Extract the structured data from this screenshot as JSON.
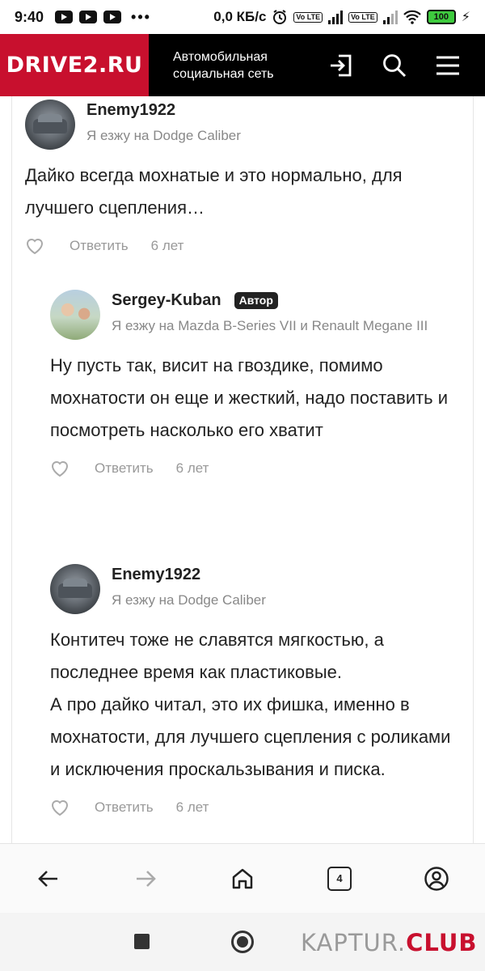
{
  "status_bar": {
    "time": "9:40",
    "dots": "•••",
    "network_speed": "0,0 КБ/с",
    "volte1": "Vo LTE",
    "volte2": "Vo LTE",
    "battery": "100"
  },
  "header": {
    "logo": "DRIVE2.RU",
    "tagline": "Автомобильная социальная сеть",
    "icons": [
      "login-icon",
      "search-icon",
      "menu-icon"
    ]
  },
  "comments": [
    {
      "author": "Enemy1922",
      "badge": "",
      "car": "Я езжу на Dodge Caliber",
      "text": "Дайко всегда мохнатые и это нормально, для лучшего сцепления…",
      "reply": "Ответить",
      "ago": "6 лет"
    },
    {
      "author": "Sergey-Kuban",
      "badge": "Автор",
      "car": "Я езжу на Mazda B-Series VII и Renault Megane III",
      "text": "Ну пусть так, висит на гвоздике, помимо мохнатости он еще и жесткий, надо поставить и посмотреть насколько его хватит",
      "reply": "Ответить",
      "ago": "6 лет"
    },
    {
      "author": "Enemy1922",
      "badge": "",
      "car": "Я езжу на Dodge Caliber",
      "text_line1": "Контитеч тоже не славятся мягкостью, а последнее время как пластиковые.",
      "text_line2": "А про дайко читал, это их фишка, именно в мохнатости, для лучшего сцепления с роликами и исключения проскальзывания и писка.",
      "reply": "Ответить",
      "ago": "6 лет"
    }
  ],
  "browser_nav": {
    "tabs_count": "4",
    "icons": [
      "back-arrow-icon",
      "forward-arrow-icon",
      "home-icon",
      "tabs-icon",
      "profile-icon"
    ]
  },
  "watermark": {
    "part1": "KAPTUR.",
    "part2": "CLUB"
  }
}
